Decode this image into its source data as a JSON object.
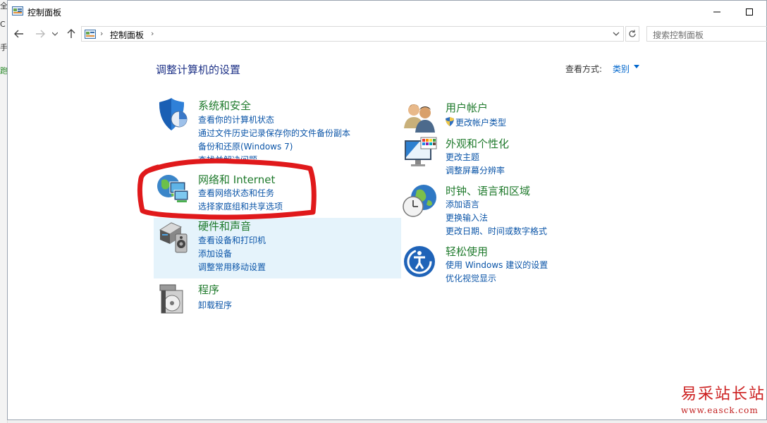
{
  "background_edge": {
    "fragments": [
      "全",
      "C",
      "手",
      "跑"
    ]
  },
  "window": {
    "title": "控制面板",
    "accent": "#0b55a8"
  },
  "addressbar": {
    "breadcrumb": "控制面板",
    "search_placeholder": "搜索控制面板"
  },
  "main": {
    "title": "调整计算机的设置",
    "view_by_label": "查看方式:",
    "view_by_value": "类别"
  },
  "categories": [
    {
      "icon": "security-shield-icon",
      "title": "系统和安全",
      "links": [
        "查看你的计算机状态",
        "通过文件历史记录保存你的文件备份副本",
        "备份和还原(Windows 7)",
        "查找并解决问题"
      ]
    },
    {
      "icon": "network-globe-icon",
      "title": "网络和 Internet",
      "links": [
        "查看网络状态和任务",
        "选择家庭组和共享选项"
      ]
    },
    {
      "icon": "printer-speaker-icon",
      "title": "硬件和声音",
      "links": [
        "查看设备和打印机",
        "添加设备",
        "调整常用移动设置"
      ]
    },
    {
      "icon": "programs-disc-icon",
      "title": "程序",
      "links": [
        "卸载程序"
      ]
    },
    {
      "icon": "users-icon",
      "title": "用户帐户",
      "links": [
        "更改帐户类型"
      ]
    },
    {
      "icon": "monitor-palette-icon",
      "title": "外观和个性化",
      "links": [
        "更改主题",
        "调整屏幕分辨率"
      ]
    },
    {
      "icon": "clock-globe-icon",
      "title": "时钟、语言和区域",
      "links": [
        "添加语言",
        "更换输入法",
        "更改日期、时间或数字格式"
      ]
    },
    {
      "icon": "ease-of-access-icon",
      "title": "轻松使用",
      "links": [
        "使用 Windows 建议的设置",
        "优化视觉显示"
      ]
    }
  ],
  "watermark": {
    "title": "易采站长站",
    "url": "www.easck.com"
  }
}
